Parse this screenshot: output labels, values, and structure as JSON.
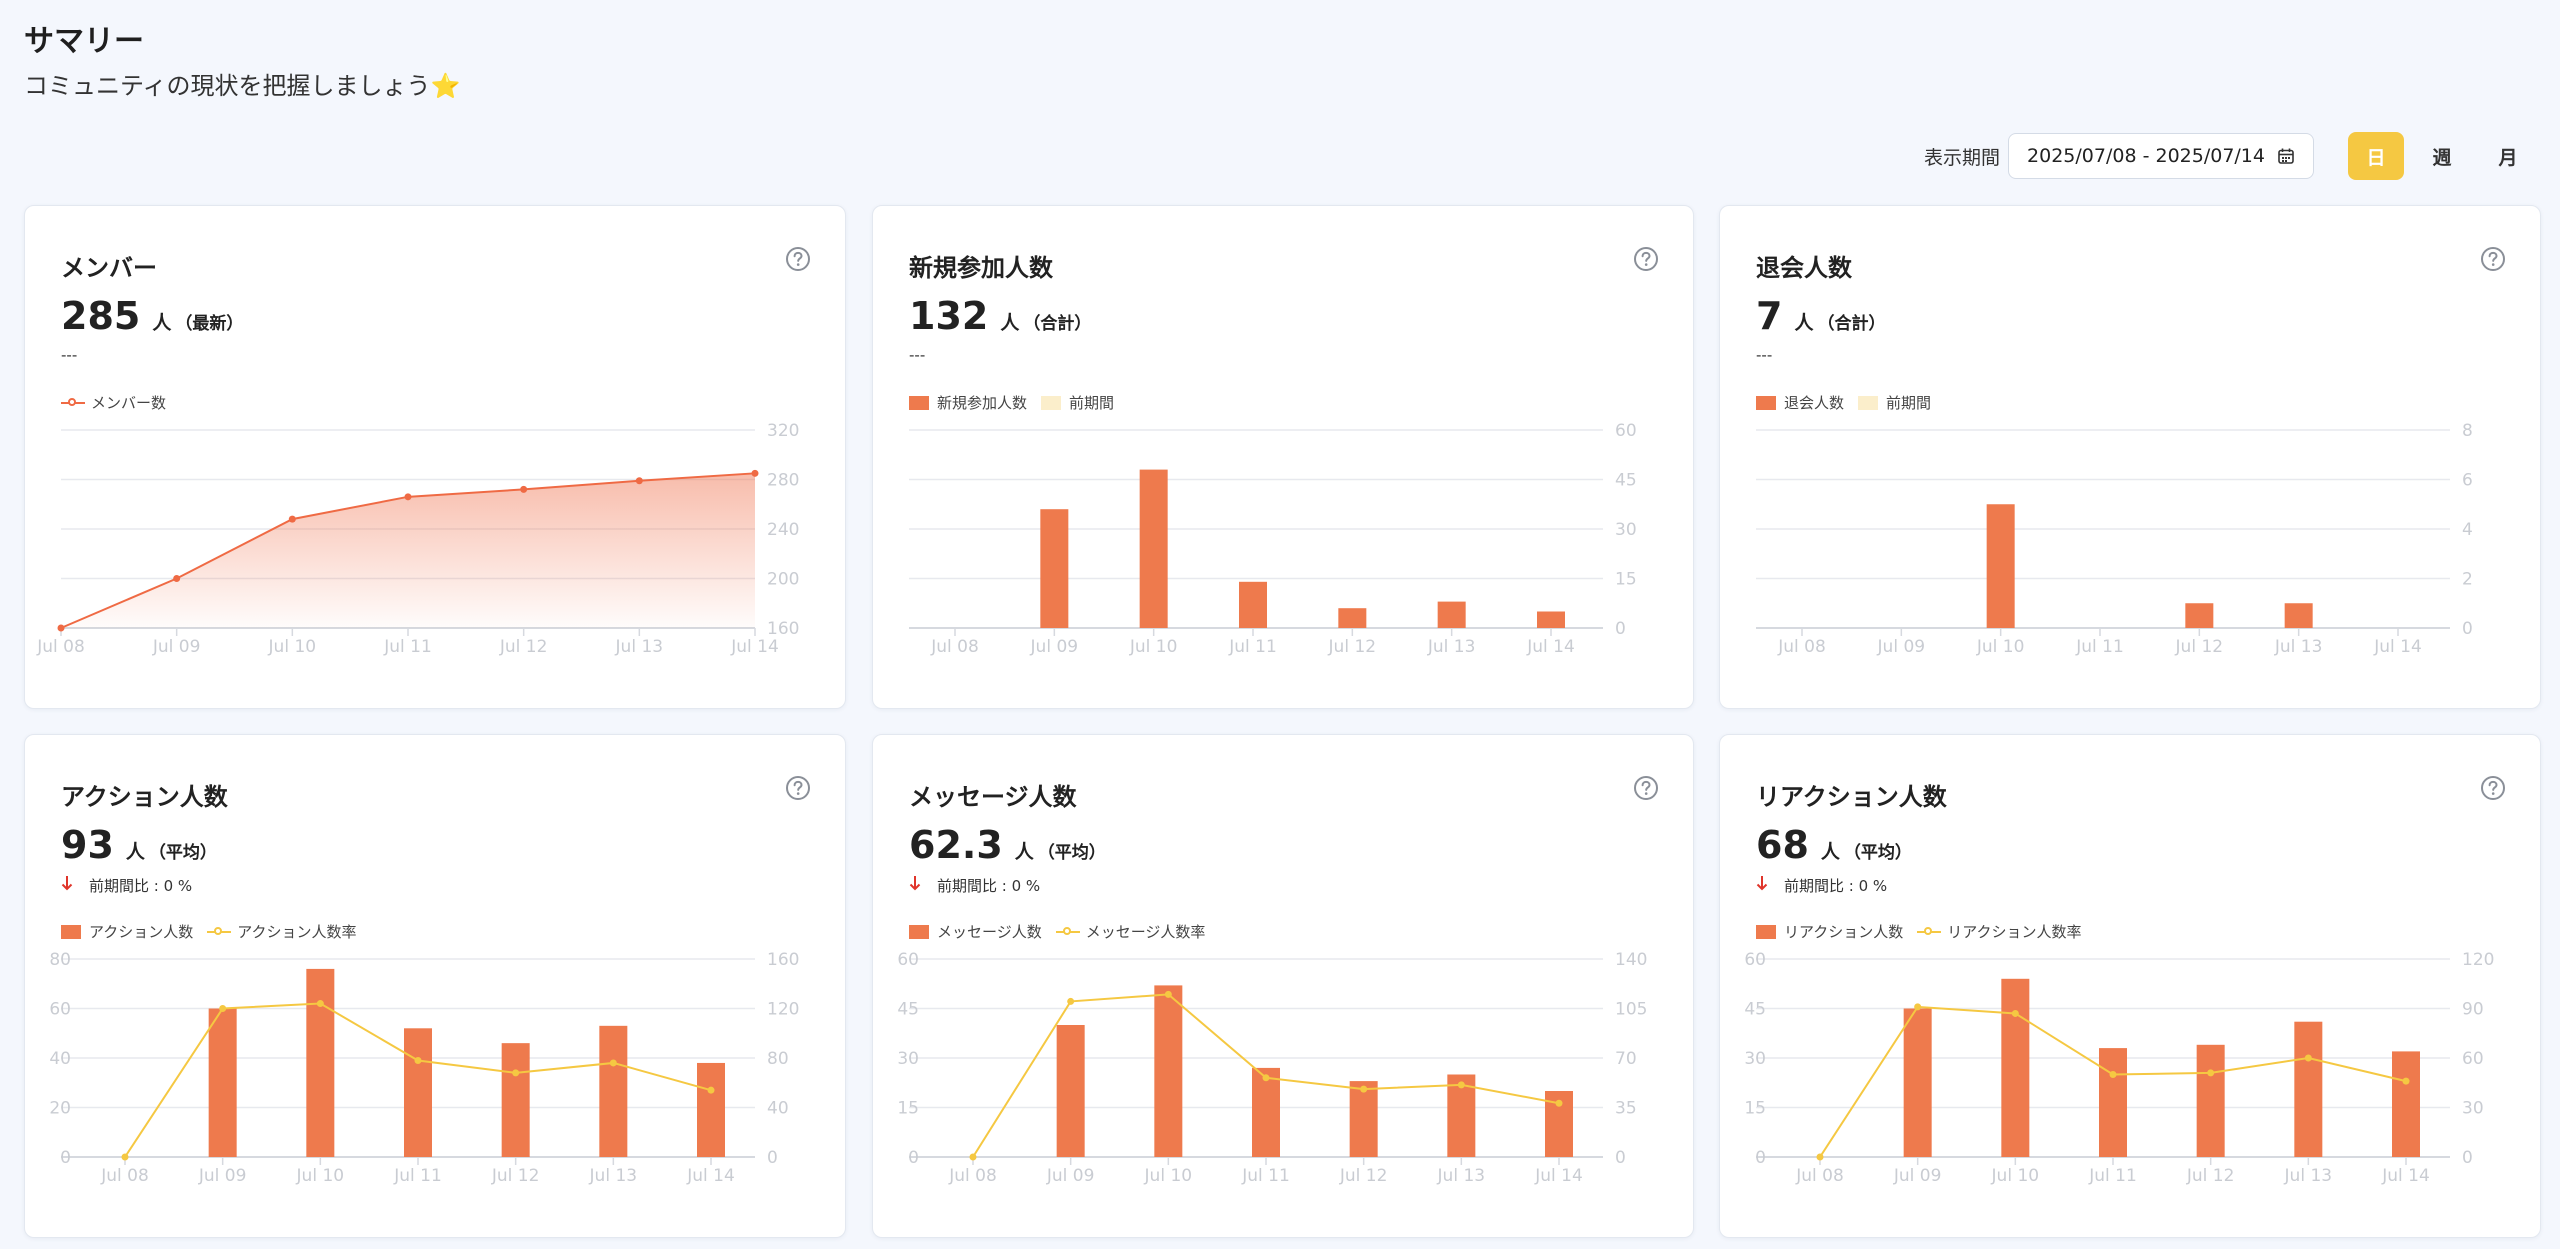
{
  "header": {
    "title": "サマリー",
    "subtitle": "コミュニティの現状を把握しましょう⭐"
  },
  "toolbar": {
    "period_label": "表示期間",
    "date_range": "2025/07/08 - 2025/07/14",
    "periods": [
      {
        "label": "日",
        "active": true
      },
      {
        "label": "週",
        "active": false
      },
      {
        "label": "月",
        "active": false
      }
    ]
  },
  "colors": {
    "bar": "#ee7a4d",
    "prev_bar": "#fbeecb",
    "line": "#f5c842",
    "member_line": "#ef6a44",
    "active_button": "#f5c842",
    "down_arrow": "#e0352b"
  },
  "icons": {
    "help": "question-circle-icon",
    "calendar": "calendar-icon",
    "down_arrow": "arrow-down-icon"
  },
  "cards": [
    {
      "title": "メンバー",
      "value": "285",
      "unit": "人",
      "unit_note": "（最新）",
      "note": "---",
      "comparison": null,
      "legend": [
        {
          "label": "メンバー数",
          "kind": "line-red"
        }
      ]
    },
    {
      "title": "新規参加人数",
      "value": "132",
      "unit": "人",
      "unit_note": "（合計）",
      "note": "---",
      "comparison": null,
      "legend": [
        {
          "label": "新規参加人数",
          "kind": "bar"
        },
        {
          "label": "前期間",
          "kind": "prev"
        }
      ]
    },
    {
      "title": "退会人数",
      "value": "7",
      "unit": "人",
      "unit_note": "（合計）",
      "note": "---",
      "comparison": null,
      "legend": [
        {
          "label": "退会人数",
          "kind": "bar"
        },
        {
          "label": "前期間",
          "kind": "prev"
        }
      ]
    },
    {
      "title": "アクション人数",
      "value": "93",
      "unit": "人",
      "unit_note": "（平均）",
      "note": null,
      "comparison": "前期間比 : 0 %",
      "legend": [
        {
          "label": "アクション人数",
          "kind": "bar"
        },
        {
          "label": "アクション人数率",
          "kind": "line-yellow"
        }
      ]
    },
    {
      "title": "メッセージ人数",
      "value": "62.3",
      "unit": "人",
      "unit_note": "（平均）",
      "note": null,
      "comparison": "前期間比 : 0 %",
      "legend": [
        {
          "label": "メッセージ人数",
          "kind": "bar"
        },
        {
          "label": "メッセージ人数率",
          "kind": "line-yellow"
        }
      ]
    },
    {
      "title": "リアクション人数",
      "value": "68",
      "unit": "人",
      "unit_note": "（平均）",
      "note": null,
      "comparison": "前期間比 : 0 %",
      "legend": [
        {
          "label": "リアクション人数",
          "kind": "bar"
        },
        {
          "label": "リアクション人数率",
          "kind": "line-yellow"
        }
      ]
    }
  ],
  "chart_data": [
    {
      "type": "area",
      "categories": [
        "Jul 08",
        "Jul 09",
        "Jul 10",
        "Jul 11",
        "Jul 12",
        "Jul 13",
        "Jul 14"
      ],
      "series": [
        {
          "name": "メンバー数",
          "values": [
            160,
            200,
            248,
            266,
            272,
            279,
            285
          ]
        }
      ],
      "yticks": [
        160,
        200,
        240,
        280,
        320
      ],
      "ylim": [
        160,
        320
      ],
      "y_axis_side": "right",
      "grid": true
    },
    {
      "type": "bar",
      "categories": [
        "Jul 08",
        "Jul 09",
        "Jul 10",
        "Jul 11",
        "Jul 12",
        "Jul 13",
        "Jul 14"
      ],
      "series": [
        {
          "name": "新規参加人数",
          "values": [
            0,
            36,
            48,
            14,
            6,
            8,
            5
          ]
        }
      ],
      "yticks": [
        0,
        15,
        30,
        45,
        60
      ],
      "ylim": [
        0,
        60
      ],
      "y_axis_side": "right",
      "grid": true
    },
    {
      "type": "bar",
      "categories": [
        "Jul 08",
        "Jul 09",
        "Jul 10",
        "Jul 11",
        "Jul 12",
        "Jul 13",
        "Jul 14"
      ],
      "series": [
        {
          "name": "退会人数",
          "values": [
            0,
            0,
            5,
            0,
            1,
            1,
            0
          ]
        }
      ],
      "yticks": [
        0,
        2,
        4,
        6,
        8
      ],
      "ylim": [
        0,
        8
      ],
      "y_axis_side": "right",
      "grid": true
    },
    {
      "type": "bar",
      "categories": [
        "Jul 08",
        "Jul 09",
        "Jul 10",
        "Jul 11",
        "Jul 12",
        "Jul 13",
        "Jul 14"
      ],
      "series": [
        {
          "name": "アクション人数",
          "values": [
            0,
            60,
            76,
            52,
            46,
            53,
            38
          ]
        },
        {
          "name": "アクション人数率",
          "values": [
            0,
            120,
            124,
            78,
            68,
            76,
            54
          ],
          "axis": "right",
          "kind": "line"
        }
      ],
      "yticks_left": [
        0,
        20,
        40,
        60,
        80
      ],
      "ylim_left": [
        0,
        80
      ],
      "yticks_right": [
        0,
        40,
        80,
        120,
        160
      ],
      "ylim_right": [
        0,
        160
      ],
      "grid": true
    },
    {
      "type": "bar",
      "categories": [
        "Jul 08",
        "Jul 09",
        "Jul 10",
        "Jul 11",
        "Jul 12",
        "Jul 13",
        "Jul 14"
      ],
      "series": [
        {
          "name": "メッセージ人数",
          "values": [
            0,
            40,
            52,
            27,
            23,
            25,
            20
          ]
        },
        {
          "name": "メッセージ人数率",
          "values": [
            0,
            110,
            115,
            56,
            48,
            51,
            38
          ],
          "axis": "right",
          "kind": "line"
        }
      ],
      "yticks_left": [
        0,
        15,
        30,
        45,
        60
      ],
      "ylim_left": [
        0,
        60
      ],
      "yticks_right": [
        0,
        35,
        70,
        105,
        140
      ],
      "ylim_right": [
        0,
        140
      ],
      "grid": true
    },
    {
      "type": "bar",
      "categories": [
        "Jul 08",
        "Jul 09",
        "Jul 10",
        "Jul 11",
        "Jul 12",
        "Jul 13",
        "Jul 14"
      ],
      "series": [
        {
          "name": "リアクション人数",
          "values": [
            0,
            45,
            54,
            33,
            34,
            41,
            32
          ]
        },
        {
          "name": "リアクション人数率",
          "values": [
            0,
            91,
            87,
            50,
            51,
            60,
            46
          ],
          "axis": "right",
          "kind": "line"
        }
      ],
      "yticks_left": [
        0,
        15,
        30,
        45,
        60
      ],
      "ylim_left": [
        0,
        60
      ],
      "yticks_right": [
        0,
        30,
        60,
        90,
        120
      ],
      "ylim_right": [
        0,
        120
      ],
      "grid": true
    }
  ]
}
